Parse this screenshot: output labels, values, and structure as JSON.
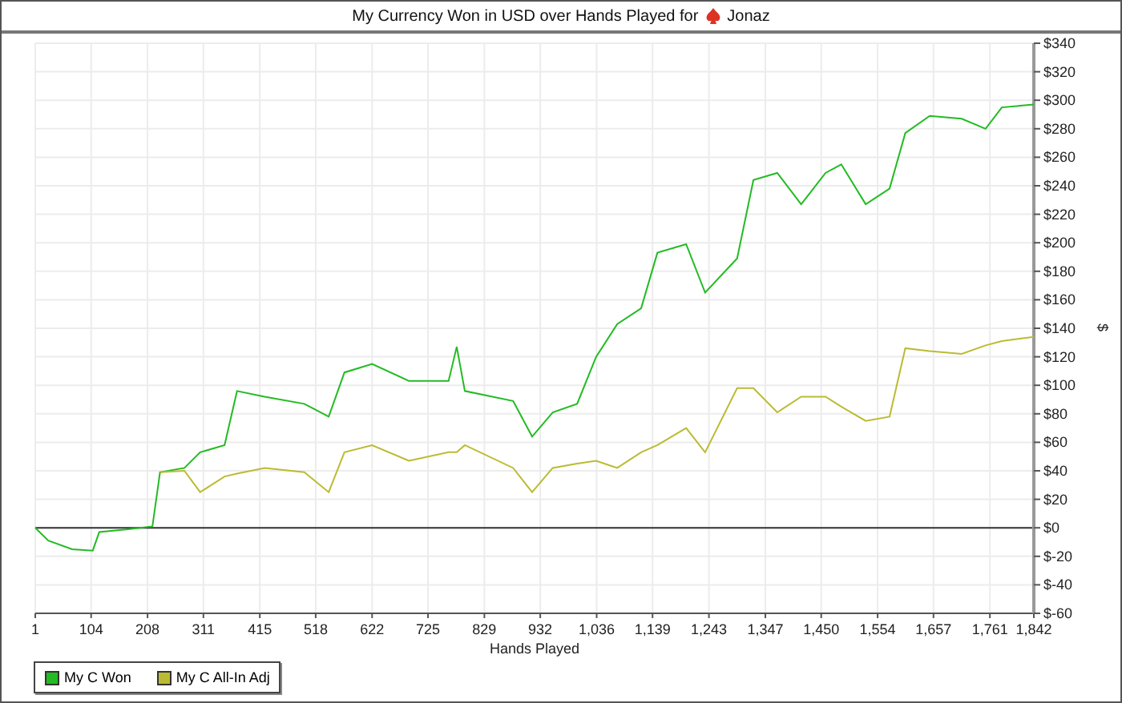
{
  "title": {
    "text": "My Currency Won in USD over Hands Played for",
    "player": "Jonaz"
  },
  "chart_data": {
    "type": "line",
    "xlabel": "Hands Played",
    "ylabel": "$",
    "x": [
      1,
      25,
      69,
      107,
      119,
      172,
      217,
      231,
      276,
      305,
      350,
      373,
      424,
      497,
      542,
      571,
      622,
      690,
      763,
      778,
      793,
      882,
      917,
      955,
      1000,
      1035,
      1074,
      1118,
      1148,
      1201,
      1236,
      1295,
      1325,
      1369,
      1413,
      1458,
      1487,
      1532,
      1576,
      1605,
      1650,
      1709,
      1753,
      1783,
      1842
    ],
    "series": [
      {
        "name": "My C Won",
        "color": "#22bb22",
        "values": [
          0,
          -9,
          -15,
          -16,
          -3,
          -1,
          1,
          39,
          42,
          53,
          58,
          96,
          92,
          87,
          78,
          109,
          115,
          103,
          103,
          127,
          96,
          89,
          64,
          81,
          87,
          120,
          143,
          154,
          193,
          199,
          165,
          189,
          244,
          249,
          227,
          249,
          255,
          227,
          238,
          277,
          289,
          287,
          280,
          295,
          297
        ]
      },
      {
        "name": "My C All-In Adj",
        "color": "#bbbb33",
        "values": [
          null,
          null,
          null,
          null,
          null,
          null,
          null,
          39,
          40,
          25,
          36,
          38,
          42,
          39,
          25,
          53,
          58,
          47,
          53,
          53,
          58,
          42,
          25,
          42,
          45,
          47,
          42,
          53,
          58,
          70,
          53,
          98,
          98,
          81,
          92,
          92,
          85,
          75,
          78,
          126,
          124,
          122,
          128,
          131,
          134
        ]
      }
    ],
    "grid": true,
    "xlim": [
      1,
      1842
    ],
    "ylim": [
      -60,
      340
    ],
    "xticks": [
      {
        "value": 1,
        "label": "1"
      },
      {
        "value": 104,
        "label": "104"
      },
      {
        "value": 208,
        "label": "208"
      },
      {
        "value": 311,
        "label": "311"
      },
      {
        "value": 415,
        "label": "415"
      },
      {
        "value": 518,
        "label": "518"
      },
      {
        "value": 622,
        "label": "622"
      },
      {
        "value": 725,
        "label": "725"
      },
      {
        "value": 829,
        "label": "829"
      },
      {
        "value": 932,
        "label": "932"
      },
      {
        "value": 1036,
        "label": "1,036"
      },
      {
        "value": 1139,
        "label": "1,139"
      },
      {
        "value": 1243,
        "label": "1,243"
      },
      {
        "value": 1347,
        "label": "1,347"
      },
      {
        "value": 1450,
        "label": "1,450"
      },
      {
        "value": 1554,
        "label": "1,554"
      },
      {
        "value": 1657,
        "label": "1,657"
      },
      {
        "value": 1761,
        "label": "1,761"
      },
      {
        "value": 1842,
        "label": "1,842"
      }
    ],
    "yticks": [
      {
        "value": 340,
        "label": "$340"
      },
      {
        "value": 320,
        "label": "$320"
      },
      {
        "value": 300,
        "label": "$300"
      },
      {
        "value": 280,
        "label": "$280"
      },
      {
        "value": 260,
        "label": "$260"
      },
      {
        "value": 240,
        "label": "$240"
      },
      {
        "value": 220,
        "label": "$220"
      },
      {
        "value": 200,
        "label": "$200"
      },
      {
        "value": 180,
        "label": "$180"
      },
      {
        "value": 160,
        "label": "$160"
      },
      {
        "value": 140,
        "label": "$140"
      },
      {
        "value": 120,
        "label": "$120"
      },
      {
        "value": 100,
        "label": "$100"
      },
      {
        "value": 80,
        "label": "$80"
      },
      {
        "value": 60,
        "label": "$60"
      },
      {
        "value": 40,
        "label": "$40"
      },
      {
        "value": 20,
        "label": "$20"
      },
      {
        "value": 0,
        "label": "$0"
      },
      {
        "value": -20,
        "label": "$-20"
      },
      {
        "value": -40,
        "label": "$-40"
      },
      {
        "value": -60,
        "label": "$-60"
      }
    ]
  }
}
